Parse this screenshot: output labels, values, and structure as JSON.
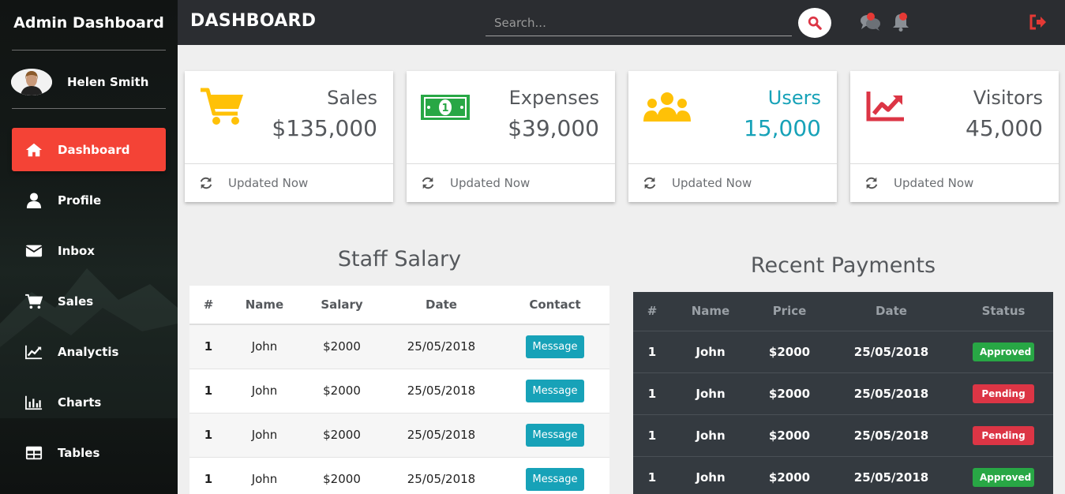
{
  "sidebar": {
    "brand": "Admin Dashboard",
    "user_name": "Helen Smith",
    "items": [
      {
        "label": "Dashboard",
        "icon": "home-icon"
      },
      {
        "label": "Profile",
        "icon": "user-icon"
      },
      {
        "label": "Inbox",
        "icon": "envelope-icon"
      },
      {
        "label": "Sales",
        "icon": "cart-icon"
      },
      {
        "label": "Analyctis",
        "icon": "line-chart-icon"
      },
      {
        "label": "Charts",
        "icon": "bar-chart-icon"
      },
      {
        "label": "Tables",
        "icon": "table-icon"
      }
    ],
    "active_color": "#f44336"
  },
  "header": {
    "title": "DASHBOARD",
    "search_placeholder": "Search..."
  },
  "cards": [
    {
      "label": "Sales",
      "value": "$135,000",
      "footer": "Updated Now",
      "icon": "cart-icon",
      "icon_color": "#ffc107"
    },
    {
      "label": "Expenses",
      "value": "$39,000",
      "footer": "Updated Now",
      "icon": "money-icon",
      "icon_color": "#28a745"
    },
    {
      "label": "Users",
      "value": "15,000",
      "footer": "Updated Now",
      "icon": "users-icon",
      "icon_color": "#ffc107"
    },
    {
      "label": "Visitors",
      "value": "45,000",
      "footer": "Updated Now",
      "icon": "trend-up-icon",
      "icon_color": "#dc3545"
    }
  ],
  "staff_salary": {
    "title": "Staff Salary",
    "headers": [
      "#",
      "Name",
      "Salary",
      "Date",
      "Contact"
    ],
    "button_label": "Message",
    "rows": [
      [
        "1",
        "John",
        "$2000",
        "25/05/2018"
      ],
      [
        "1",
        "John",
        "$2000",
        "25/05/2018"
      ],
      [
        "1",
        "John",
        "$2000",
        "25/05/2018"
      ],
      [
        "1",
        "John",
        "$2000",
        "25/05/2018"
      ]
    ]
  },
  "recent_payments": {
    "title": "Recent Payments",
    "headers": [
      "#",
      "Name",
      "Price",
      "Date",
      "Status"
    ],
    "rows": [
      [
        "1",
        "John",
        "$2000",
        "25/05/2018",
        "Approved"
      ],
      [
        "1",
        "John",
        "$2000",
        "25/05/2018",
        "Pending"
      ],
      [
        "1",
        "John",
        "$2000",
        "25/05/2018",
        "Pending"
      ],
      [
        "1",
        "John",
        "$2000",
        "25/05/2018",
        "Approved"
      ]
    ]
  }
}
